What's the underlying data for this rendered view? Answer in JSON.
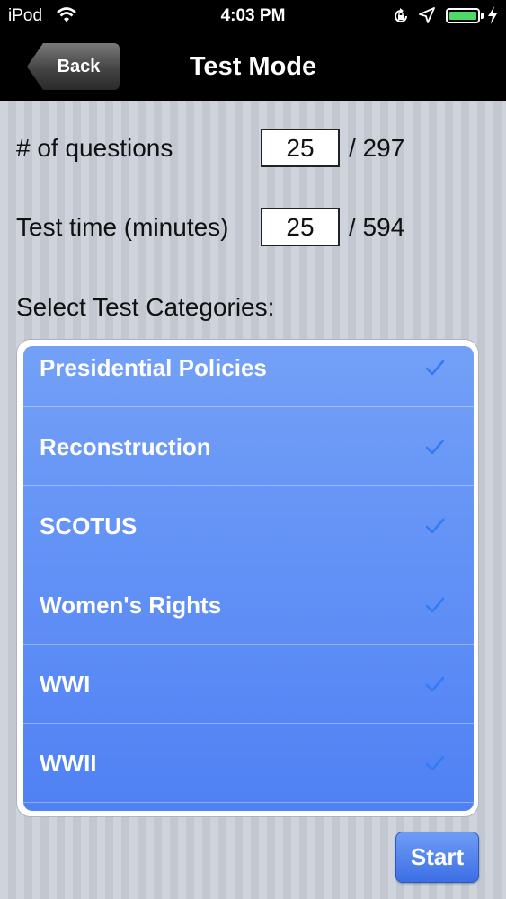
{
  "status_bar": {
    "carrier": "iPod",
    "time": "4:03 PM",
    "battery_level": 1.0,
    "battery_color": "#4cd964",
    "icons": [
      "wifi-icon",
      "orientation-lock-icon",
      "location-icon",
      "battery-icon",
      "charging-bolt-icon"
    ]
  },
  "nav": {
    "back_label": "Back",
    "title": "Test Mode"
  },
  "form": {
    "questions_label": "# of questions",
    "questions_value": "25",
    "questions_total": "/ 297",
    "time_label": "Test time (minutes)",
    "time_value": "25",
    "time_total": "/ 594"
  },
  "categories": {
    "title": "Select Test Categories:",
    "items": [
      {
        "label": "Presidential Policies",
        "checked": true
      },
      {
        "label": "Reconstruction",
        "checked": true
      },
      {
        "label": "SCOTUS",
        "checked": true
      },
      {
        "label": "Women's Rights",
        "checked": true
      },
      {
        "label": "WWI",
        "checked": true
      },
      {
        "label": "WWII",
        "checked": true
      }
    ],
    "check_color": "#2f7cf6",
    "list_color": "#5b8bf5"
  },
  "start_label": "Start"
}
